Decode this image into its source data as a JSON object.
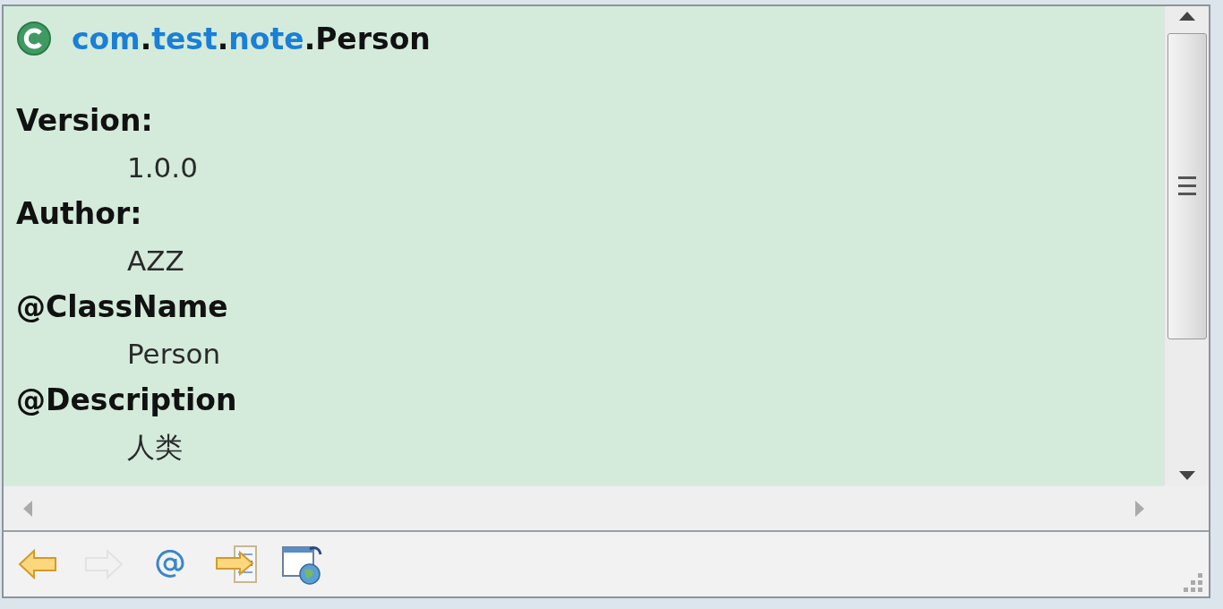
{
  "title": {
    "parts": [
      {
        "text": "com",
        "kind": "link"
      },
      {
        "text": ".",
        "kind": "plain"
      },
      {
        "text": "test",
        "kind": "link"
      },
      {
        "text": ".",
        "kind": "plain"
      },
      {
        "text": "note",
        "kind": "link"
      },
      {
        "text": ".",
        "kind": "plain"
      },
      {
        "text": "Person",
        "kind": "plain"
      }
    ]
  },
  "tags": [
    {
      "label": "Version:",
      "value": "1.0.0"
    },
    {
      "label": "Author:",
      "value": "AZZ"
    },
    {
      "label": "@ClassName",
      "value": "Person"
    },
    {
      "label": "@Description",
      "value": "人类"
    }
  ],
  "toolbar": [
    {
      "kind": "back",
      "disabled": false
    },
    {
      "kind": "forward",
      "disabled": true
    },
    {
      "kind": "at",
      "disabled": false
    },
    {
      "kind": "open",
      "disabled": false
    },
    {
      "kind": "browser",
      "disabled": false
    }
  ]
}
